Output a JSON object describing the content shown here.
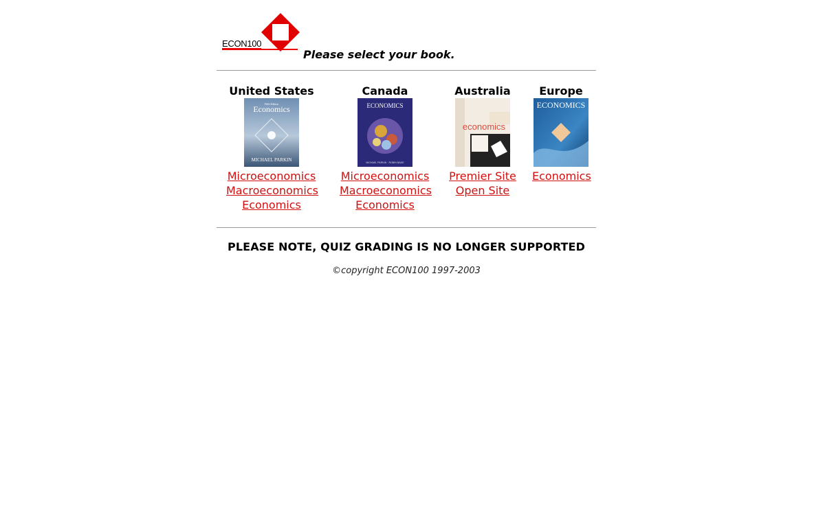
{
  "header": {
    "logo_text": "ECON100",
    "tagline": "Please select your book."
  },
  "regions": [
    {
      "title": "United States",
      "cover": {
        "title": "Economics",
        "subtitle": "Fifth Edition",
        "author": "MICHAEL PARKIN"
      },
      "links": [
        "Microeconomics",
        "Macroeconomics",
        "Economics"
      ]
    },
    {
      "title": "Canada",
      "cover": {
        "title": "ECONOMICS",
        "author": "MICHAEL PARKIN · ROBIN BADE"
      },
      "links": [
        "Microeconomics",
        "Macroeconomics",
        "Economics"
      ]
    },
    {
      "title": "Australia",
      "cover": {
        "title": "economics"
      },
      "links": [
        "Premier Site",
        "Open Site"
      ]
    },
    {
      "title": "Europe",
      "cover": {
        "title": "ECONOMICS"
      },
      "links": [
        "Economics"
      ]
    }
  ],
  "notice": "PLEASE NOTE, QUIZ GRADING IS NO LONGER SUPPORTED",
  "copyright": "©copyright ECON100 1997-2003",
  "colors": {
    "link": "#d01010",
    "brand_red": "#e00000",
    "rule": "#9a9a9a"
  }
}
